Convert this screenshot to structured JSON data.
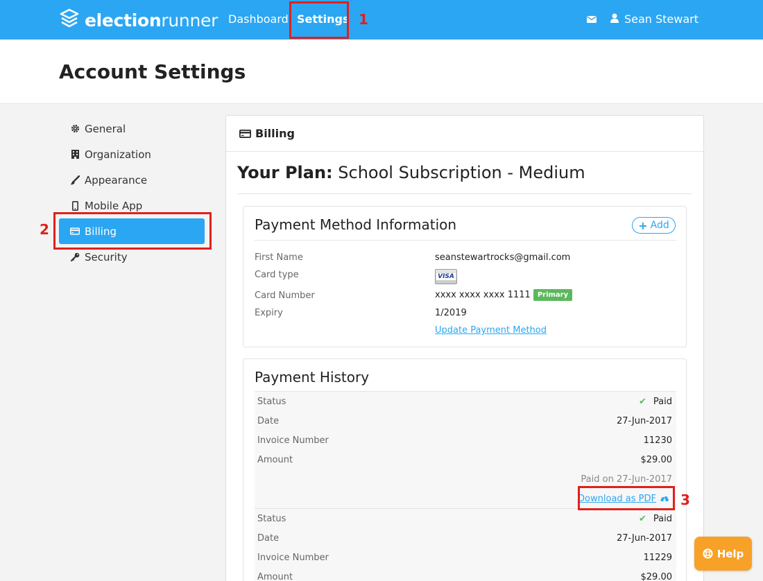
{
  "topnav": {
    "logo_bold": "election",
    "logo_light": "runner",
    "dashboard_label": "Dashboard",
    "settings_label": "Settings",
    "user_name": "Sean Stewart"
  },
  "page": {
    "title": "Account Settings"
  },
  "sidebar": {
    "items": [
      {
        "label": "General",
        "icon": "gear-icon"
      },
      {
        "label": "Organization",
        "icon": "building-icon"
      },
      {
        "label": "Appearance",
        "icon": "brush-icon"
      },
      {
        "label": "Mobile App",
        "icon": "mobile-icon"
      },
      {
        "label": "Billing",
        "icon": "credit-card-icon",
        "active": true
      },
      {
        "label": "Security",
        "icon": "key-icon"
      }
    ]
  },
  "billing": {
    "header": "Billing",
    "plan_label": "Your Plan:",
    "plan_name": "School Subscription - Medium",
    "payment_method": {
      "title": "Payment Method Information",
      "add_label": "Add",
      "first_name_label": "First Name",
      "first_name_value": "seanstewartrocks@gmail.com",
      "card_type_label": "Card type",
      "card_type_value": "VISA",
      "card_number_label": "Card Number",
      "card_number_value": "xxxx xxxx xxxx 1111",
      "primary_badge": "Primary",
      "expiry_label": "Expiry",
      "expiry_value": "1/2019",
      "update_link": "Update Payment Method"
    },
    "payment_history": {
      "title": "Payment History",
      "entries": [
        {
          "status_label": "Status",
          "status_value": "Paid",
          "date_label": "Date",
          "date_value": "27-Jun-2017",
          "invoice_label": "Invoice Number",
          "invoice_value": "11230",
          "amount_label": "Amount",
          "amount_value": "$29.00",
          "paid_on": "Paid on 27-Jun-2017",
          "download_label": "Download as PDF"
        },
        {
          "status_label": "Status",
          "status_value": "Paid",
          "date_label": "Date",
          "date_value": "27-Jun-2017",
          "invoice_label": "Invoice Number",
          "invoice_value": "11229",
          "amount_label": "Amount",
          "amount_value": "$29.00"
        }
      ]
    }
  },
  "annotations": [
    "1",
    "2",
    "3"
  ],
  "help": {
    "label": "Help"
  },
  "colors": {
    "brand": "#2ba6f3",
    "annotation": "#e0201b",
    "success": "#5cb85c",
    "help": "#f7a128"
  }
}
